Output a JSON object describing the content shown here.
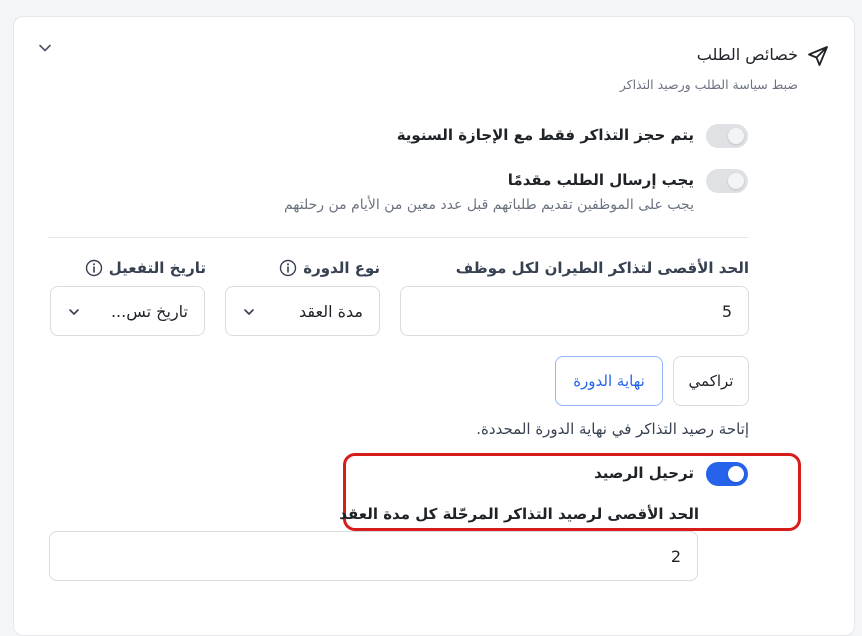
{
  "section": {
    "title": "خصائص الطلب",
    "subtitle": "ضبط سياسة الطلب ورصيد التذاكر"
  },
  "toggles": {
    "annual_leave_only": {
      "label": "يتم حجز التذاكر فقط مع الإجازة السنوية",
      "state": "off"
    },
    "advance_request": {
      "label": "يجب إرسال الطلب مقدمًا",
      "description": "يجب على الموظفين تقديم طلباتهم قبل عدد معين من الأيام من رحلتهم",
      "state": "off"
    },
    "carry_over": {
      "label": "ترحيل الرصيد",
      "state": "on"
    }
  },
  "fields": {
    "max_tickets": {
      "label": "الحد الأقصى لتذاكر الطيران لكل موظف",
      "value": "5"
    },
    "cycle_type": {
      "label": "نوع الدورة",
      "selected": "مدة العقد"
    },
    "activation_date": {
      "label": "تاريخ التفعيل",
      "selected": "تاريخ تس..."
    },
    "max_carry": {
      "label": "الحد الأقصى لرصيد التذاكر المرحّلة كل مدة العقد",
      "value": "2"
    }
  },
  "accrual": {
    "options": [
      "تراكمي",
      "نهاية الدورة"
    ],
    "selected": "نهاية الدورة",
    "description": "إتاحة رصيد التذاكر في نهاية الدورة المحددة."
  },
  "colors": {
    "accent": "#2563eb",
    "highlight": "#d81b1b",
    "toggle_off": "#dfe1e5"
  }
}
